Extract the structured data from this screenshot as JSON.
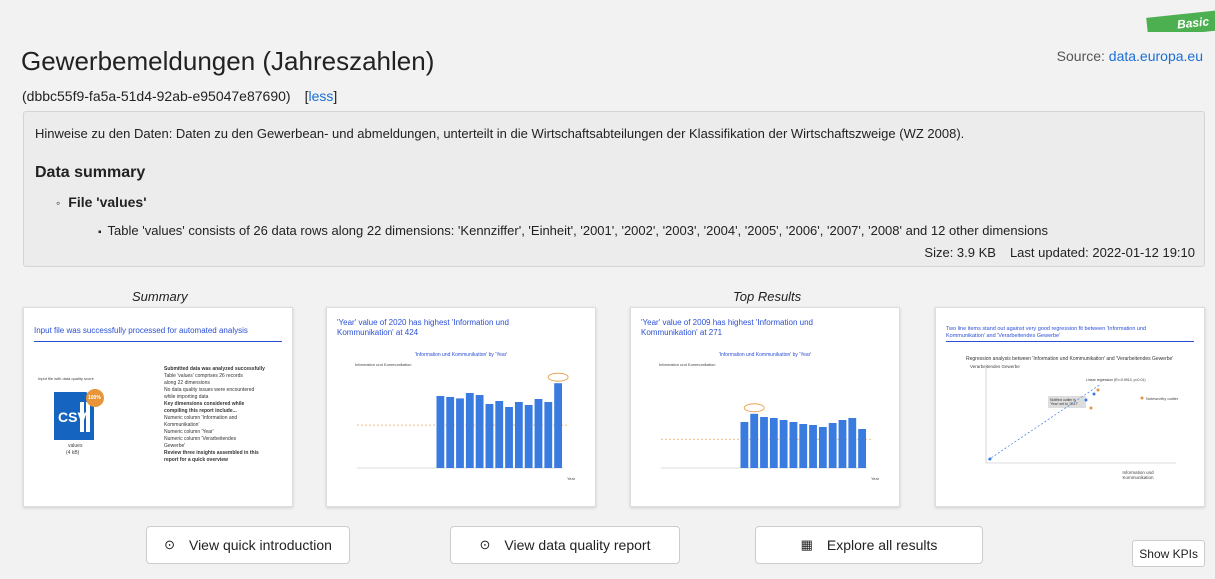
{
  "badge": "Basic",
  "title": "Gewerbemeldungen (Jahreszahlen)",
  "source": {
    "label": "Source:",
    "link": "data.europa.eu"
  },
  "identifier": {
    "id": "(dbbc55f9-fa5a-51d4-92ab-e95047e87690)",
    "toggle": "less"
  },
  "notes": {
    "hint": "Hinweise zu den Daten: Daten zu den Gewerbean- und abmeldungen, unterteilt in die Wirtschaftsabteilungen der Klassifikation der Wirtschaftszweige (WZ 2008).",
    "summary_heading": "Data summary",
    "file_label": "File 'values'",
    "table_text": "Table 'values' consists of 26 data rows along 22 dimensions: 'Kennziffer', 'Einheit', '2001', '2002', '2003', '2004', '2005', '2006', '2007', '2008' and 12 other dimensions",
    "size": "Size: 3.9 KB",
    "updated": "Last updated: 2022-01-12 19:10"
  },
  "sections": {
    "summary": "Summary",
    "top_results": "Top Results"
  },
  "cards": {
    "summary": {
      "title": "Input file was successfully processed for automated analysis",
      "csv_caption": "Input file with data quality score",
      "badge": "100%",
      "file_type": "CSV",
      "values_label": "values",
      "values_size": "(4 kB)",
      "lines": [
        "Submitted data was analyzed successfully",
        "Table 'values' comprises 26 records",
        "along 22 dimensions",
        "No data quality issues were encountered",
        "while importing data",
        "Key dimensions considered while",
        "compiling this report include...",
        "Numeric column 'Information and",
        "Kommunikation'",
        "Numeric column 'Year'",
        "Numeric column 'Verarbeitendes",
        "Gewerbe'",
        "Review three insights assembled in this",
        "report for a quick overview"
      ]
    },
    "result1": {
      "title": "'Year' value of 2020 has highest 'Information und Kommunikation' at 424",
      "chart_title": "'Information und Kommunikation' by 'Year'",
      "ylabel": "Information und Kommunikation",
      "xlabel": "Year"
    },
    "result2": {
      "title": "'Year' value of 2009 has highest 'Information und Kommunikation' at 271",
      "chart_title": "'Information und Kommunikation' by 'Year'",
      "ylabel": "Information und Kommunikation",
      "xlabel": "Year"
    },
    "result3": {
      "title": "Two line items stand out against very good regression fit between 'Information und Kommunikation' and 'Verarbeitendes Gewerbe'",
      "chart_title": "Regression analysis between 'Information und Kommunikation' and 'Verarbeitendes Gewerbe'",
      "ylabel": "Verarbeitendes Gewerbe",
      "xlabel": "Information und Kommunikation",
      "legend": "Noteworthy outlier",
      "annotation": "Notified outlier is 'Year' set to '2017'",
      "reg_label": "Linear regression (R²=0.9913, p<0.01)"
    }
  },
  "buttons": {
    "intro": "View quick introduction",
    "quality": "View data quality report",
    "explore": "Explore all results",
    "kpis": "Show KPIs"
  },
  "colors": {
    "accent": "#1a6fd6",
    "bar": "#3a7be0",
    "badge": "#4caf50",
    "highlight": "#e8953a"
  },
  "chart_data": [
    {
      "type": "bar",
      "title": "'Information und Kommunikation' by 'Year'",
      "ylabel": "Information und Kommunikation",
      "xlabel": "Year",
      "values": [
        0,
        0,
        0,
        0,
        0,
        0,
        0,
        0,
        360,
        355,
        348,
        375,
        365,
        320,
        335,
        305,
        330,
        315,
        345,
        330,
        424
      ],
      "highlight_index": 20
    },
    {
      "type": "bar",
      "title": "'Information und Kommunikation' by 'Year'",
      "ylabel": "Information und Kommunikation",
      "xlabel": "Year",
      "values": [
        0,
        0,
        0,
        0,
        0,
        0,
        0,
        0,
        230,
        271,
        255,
        250,
        240,
        230,
        220,
        215,
        205,
        225,
        240,
        250,
        195
      ],
      "highlight_index": 9
    },
    {
      "type": "scatter",
      "title": "Regression analysis between 'Information und Kommunikation' and 'Verarbeitendes Gewerbe'",
      "xlabel": "Information und Kommunikation",
      "ylabel": "Verarbeitendes Gewerbe"
    }
  ]
}
